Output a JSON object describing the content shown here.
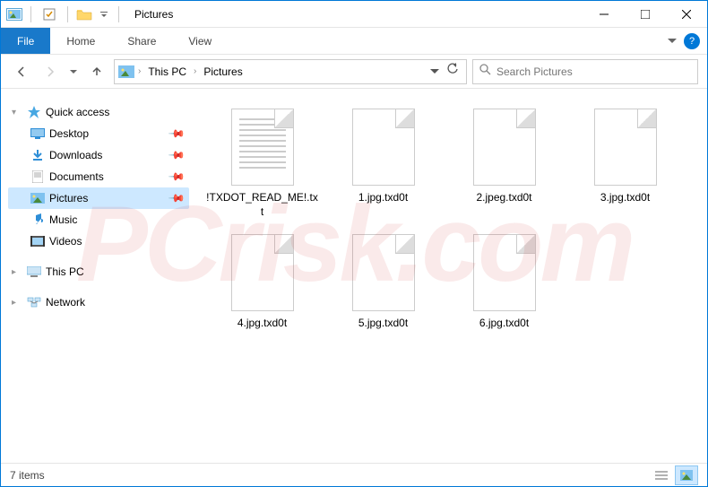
{
  "window": {
    "title": "Pictures"
  },
  "ribbon": {
    "file": "File",
    "tabs": [
      "Home",
      "Share",
      "View"
    ]
  },
  "address": {
    "crumbs": [
      "This PC",
      "Pictures"
    ]
  },
  "search": {
    "placeholder": "Search Pictures"
  },
  "sidebar": {
    "quick_access": "Quick access",
    "items": [
      {
        "label": "Desktop",
        "icon": "desktop",
        "pinned": true
      },
      {
        "label": "Downloads",
        "icon": "downloads",
        "pinned": true
      },
      {
        "label": "Documents",
        "icon": "documents",
        "pinned": true
      },
      {
        "label": "Pictures",
        "icon": "pictures",
        "pinned": true,
        "selected": true
      },
      {
        "label": "Music",
        "icon": "music",
        "pinned": false
      },
      {
        "label": "Videos",
        "icon": "videos",
        "pinned": false
      }
    ],
    "this_pc": "This PC",
    "network": "Network"
  },
  "files": [
    {
      "name": "!TXDOT_READ_ME!.txt",
      "type": "txt"
    },
    {
      "name": "1.jpg.txd0t",
      "type": "blank"
    },
    {
      "name": "2.jpeg.txd0t",
      "type": "blank"
    },
    {
      "name": "3.jpg.txd0t",
      "type": "blank"
    },
    {
      "name": "4.jpg.txd0t",
      "type": "blank"
    },
    {
      "name": "5.jpg.txd0t",
      "type": "blank"
    },
    {
      "name": "6.jpg.txd0t",
      "type": "blank"
    }
  ],
  "status": {
    "count": "7 items"
  }
}
